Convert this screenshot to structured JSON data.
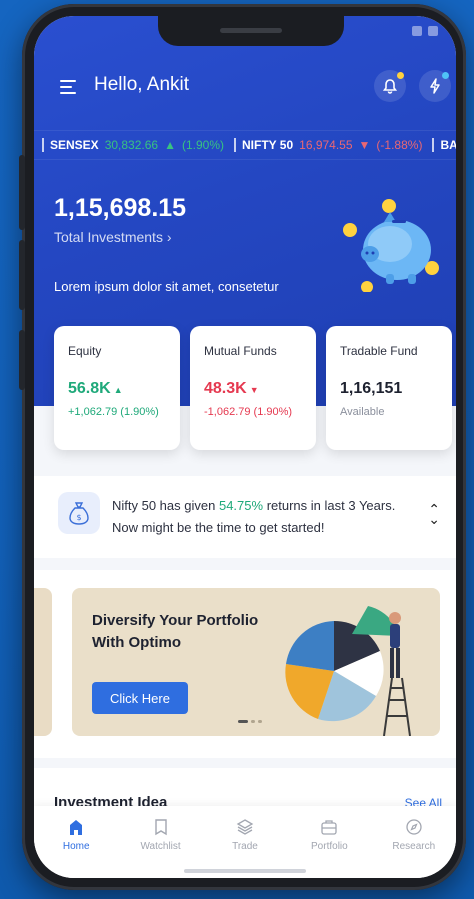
{
  "header": {
    "greeting": "Hello, Ankit"
  },
  "ticker": [
    {
      "name": "SENSEX",
      "value": "30,832.66",
      "change": "(1.90%)",
      "direction": "up"
    },
    {
      "name": "NIFTY 50",
      "value": "16,974.55",
      "change": "(-1.88%)",
      "direction": "down"
    },
    {
      "name": "BA",
      "value": "",
      "change": "",
      "direction": "up"
    }
  ],
  "summary": {
    "total_amount": "1,15,698.15",
    "total_label": "Total Investments",
    "tagline": "Lorem ipsum dolor sit amet, consetetur"
  },
  "cards": [
    {
      "title": "Equity",
      "value": "56.8K",
      "sub": "+1,062.79 (1.90%)",
      "trend": "up"
    },
    {
      "title": "Mutual Funds",
      "value": "48.3K",
      "sub": "-1,062.79 (1.90%)",
      "trend": "down"
    },
    {
      "title": "Tradable Fund",
      "value": "1,16,151",
      "sub": "Available",
      "trend": "neutral"
    }
  ],
  "info": {
    "prefix": "Nifty 50 has given",
    "highlight": "54.75%",
    "suffix": "returns in last 3 Years.",
    "line2": "Now might be the time to get started!"
  },
  "promo": {
    "title_line1": "Diversify Your Portfolio",
    "title_line2": "With Optimo",
    "button": "Click Here"
  },
  "ideas": {
    "title": "Investment Idea",
    "see_all": "See All"
  },
  "nav": [
    {
      "label": "Home",
      "icon": "home-icon",
      "active": true
    },
    {
      "label": "Watchlist",
      "icon": "bookmark-icon",
      "active": false
    },
    {
      "label": "Trade",
      "icon": "layers-icon",
      "active": false
    },
    {
      "label": "Portfolio",
      "icon": "briefcase-icon",
      "active": false
    },
    {
      "label": "Research",
      "icon": "compass-icon",
      "active": false
    }
  ],
  "colors": {
    "primary": "#2f6ee0",
    "hero": "#2447c2",
    "positive": "#1fa97a",
    "negative": "#e53950"
  }
}
